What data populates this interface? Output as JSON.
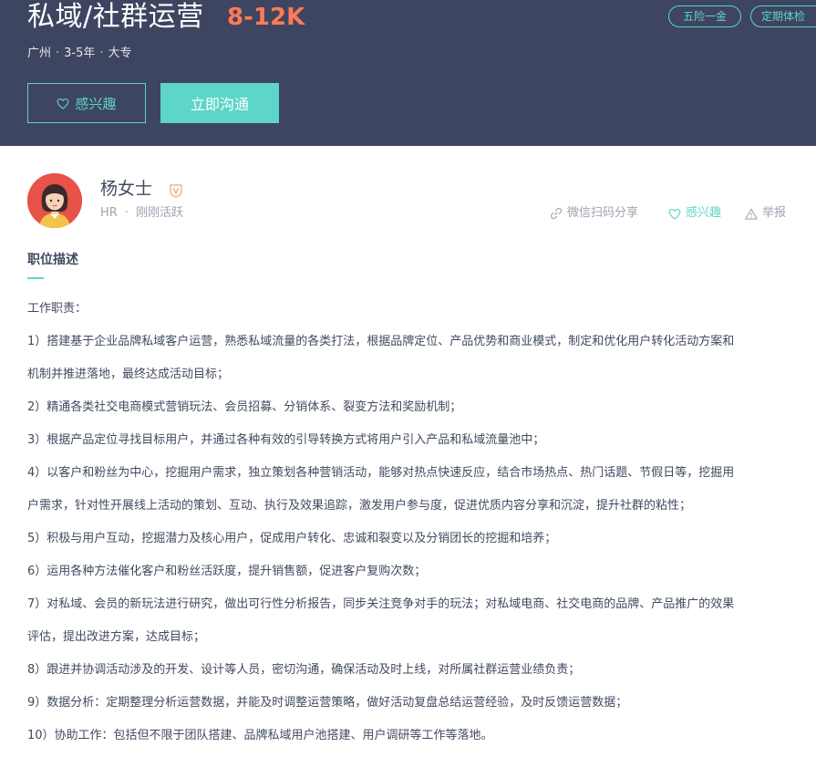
{
  "job": {
    "title": "私域/社群运营",
    "salary": "8-12K",
    "city": "广州",
    "experience": "3-5年",
    "education": "大专",
    "dot": "·",
    "tags": [
      "五险一金",
      "定期体检"
    ]
  },
  "buttons": {
    "interest_label": "感兴趣",
    "chat_label": "立即沟通"
  },
  "recruiter": {
    "name": "杨女士",
    "role": "HR",
    "status": "刚刚活跃",
    "separator": "·"
  },
  "actions": {
    "share_label": "微信扫码分享",
    "interest_label": "感兴趣",
    "report_label": "举报"
  },
  "description": {
    "title": "职位描述",
    "lines": [
      "工作职责：",
      "1）搭建基于企业品牌私域客户运营，熟悉私域流量的各类打法，根据品牌定位、产品优势和商业模式，制定和优化用户转化活动方案和",
      "机制并推进落地，最终达成活动目标；",
      "2）精通各类社交电商模式营销玩法、会员招募、分销体系、裂变方法和奖励机制；",
      "3）根据产品定位寻找目标用户，并通过各种有效的引导转换方式将用户引入产品和私域流量池中；",
      "4）以客户和粉丝为中心，挖掘用户需求，独立策划各种营销活动，能够对热点快速反应，结合市场热点、热门话题、节假日等，挖掘用",
      "户需求，针对性开展线上活动的策划、互动、执行及效果追踪，激发用户参与度，促进优质内容分享和沉淀，提升社群的粘性；",
      "5）积极与用户互动，挖掘潜力及核心用户，促成用户转化、忠诚和裂变以及分销团长的挖掘和培养；",
      "6）运用各种方法催化客户和粉丝活跃度，提升销售额，促进客户复购次数；",
      "7）对私域、会员的新玩法进行研究，做出可行性分析报告，同步关注竞争对手的玩法；对私域电商、社交电商的品牌、产品推广的效果",
      "评估，提出改进方案，达成目标；",
      "8）跟进并协调活动涉及的开发、设计等人员，密切沟通，确保活动及时上线，对所属社群运营业绩负责；",
      "9）数据分析：定期整理分析运营数据，并能及时调整运营策略，做好活动复盘总结运营经验，及时反馈运营数据；",
      "10）协助工作：包括但不限于团队搭建、品牌私域用户池搭建、用户调研等工作等落地。"
    ]
  },
  "colors": {
    "banner": "#3e4560",
    "accent": "#5dd5c8",
    "salary": "#ff7a56",
    "avatar_bg": "#e7524a"
  }
}
